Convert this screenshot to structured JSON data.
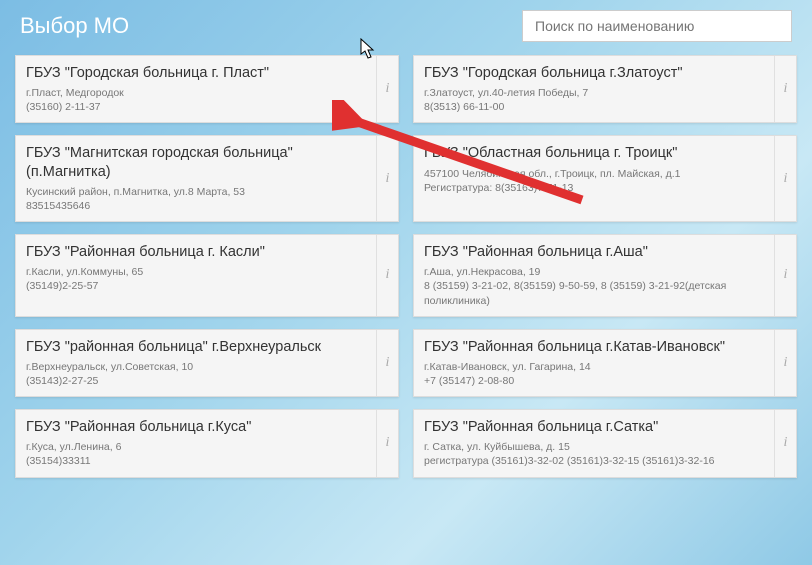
{
  "title": "Выбор МО",
  "search": {
    "placeholder": "Поиск по наименованию"
  },
  "info_label": "i",
  "cards": [
    {
      "name": "ГБУЗ \"Городская больница г. Пласт\"",
      "addr": "г.Пласт, Медгородок",
      "phone": "(35160) 2-11-37"
    },
    {
      "name": "ГБУЗ \"Городская больница г.Златоуст\"",
      "addr": "г.Златоуст, ул.40-летия Победы, 7",
      "phone": "8(3513) 66-11-00"
    },
    {
      "name": "ГБУЗ \"Магнитская городская больница\" (п.Магнитка)",
      "addr": "Кусинский район, п.Магнитка, ул.8 Марта, 53",
      "phone": "83515435646"
    },
    {
      "name": "ГБУЗ \"Областная больница г. Троицк\"",
      "addr": "457100 Челябинская обл., г.Троицк, пл. Майская, д.1",
      "phone": "Регистратура: 8(35163)7-71-13"
    },
    {
      "name": "ГБУЗ \"Районная больница г. Касли\"",
      "addr": "г.Касли, ул.Коммуны, 65",
      "phone": "(35149)2-25-57"
    },
    {
      "name": "ГБУЗ \"Районная больница г.Аша\"",
      "addr": "г.Аша, ул.Некрасова, 19",
      "phone": "8 (35159) 3-21-02, 8(35159) 9-50-59, 8 (35159) 3-21-92(детская поликлиника)"
    },
    {
      "name": "ГБУЗ \"районная больница\" г.Верхнеуральск",
      "addr": "г.Верхнеуральск, ул.Советская, 10",
      "phone": "(35143)2-27-25"
    },
    {
      "name": "ГБУЗ \"Районная больница г.Катав-Ивановск\"",
      "addr": "г.Катав-Ивановск, ул. Гагарина, 14",
      "phone": "+7 (35147) 2-08-80"
    },
    {
      "name": "ГБУЗ \"Районная больница г.Куса\"",
      "addr": "г.Куса, ул.Ленина, 6",
      "phone": "(35154)33311"
    },
    {
      "name": "ГБУЗ \"Районная больница г.Сатка\"",
      "addr": "г. Сатка, ул. Куйбышева, д. 15",
      "phone": "регистратура (35161)3-32-02 (35161)3-32-15 (35161)3-32-16"
    }
  ]
}
